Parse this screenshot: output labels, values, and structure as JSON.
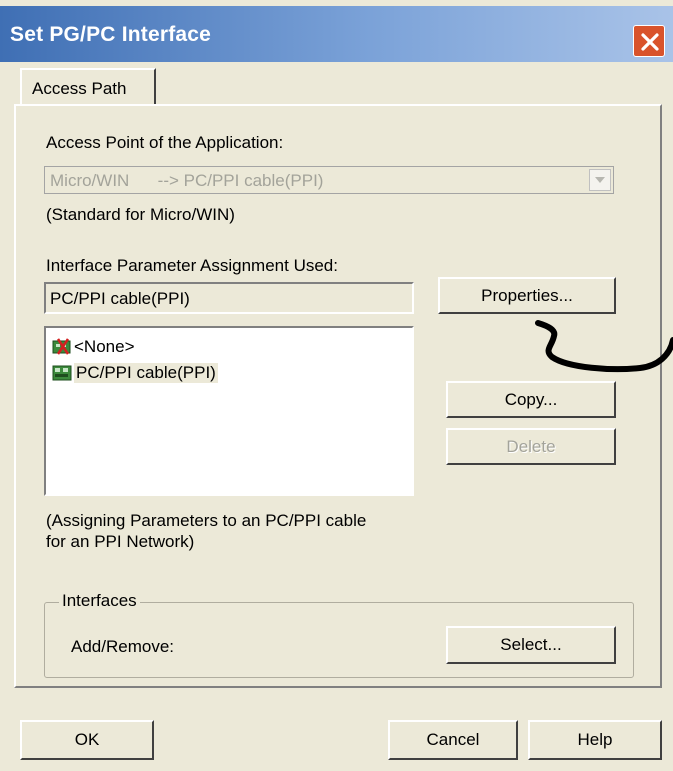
{
  "window": {
    "title": "Set PG/PC Interface"
  },
  "tabs": [
    {
      "label": "Access Path"
    }
  ],
  "access_point": {
    "label": "Access Point of the Application:",
    "value": "Micro/WIN      --> PC/PPI cable(PPI)",
    "note": "(Standard for Micro/WIN)"
  },
  "interface_param": {
    "label": "Interface Parameter Assignment Used:",
    "value": "PC/PPI cable(PPI)",
    "items": [
      {
        "label": "<None>",
        "icon": "none-interface-icon"
      },
      {
        "label": "PC/PPI cable(PPI)",
        "icon": "ppi-cable-icon",
        "selected": true
      }
    ],
    "description_line1": "(Assigning Parameters to an PC/PPI cable",
    "description_line2": "for an PPI Network)"
  },
  "buttons": {
    "properties": "Properties...",
    "copy": "Copy...",
    "delete": "Delete",
    "select": "Select...",
    "ok": "OK",
    "cancel": "Cancel",
    "help": "Help"
  },
  "interfaces_group": {
    "legend": "Interfaces",
    "add_remove_label": "Add/Remove:"
  },
  "colors": {
    "titlebar_start": "#3f6fb4",
    "titlebar_end": "#a9c3e8",
    "close_button": "#d9532b",
    "dialog_bg": "#ece9d8"
  }
}
